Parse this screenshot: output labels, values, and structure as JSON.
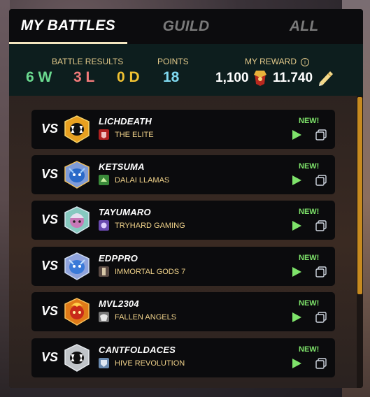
{
  "tabs": [
    {
      "label": "MY BATTLES",
      "active": true
    },
    {
      "label": "GUILD",
      "active": false
    },
    {
      "label": "ALL",
      "active": false
    }
  ],
  "summary": {
    "battle_results_label": "BATTLE RESULTS",
    "points_label": "POINTS",
    "reward_label": "MY REWARD",
    "wins": "6 W",
    "losses": "3 L",
    "draws": "0 D",
    "points": "18",
    "reward_merits": "1,100",
    "reward_sps": "11.740"
  },
  "battles": [
    {
      "vs": "VS",
      "player": "LICHDEATH",
      "guild": "THE ELITE",
      "new": "NEW!",
      "avatar": "fanged-mouth-icon",
      "avatar_color": "#e8a020",
      "guild_color": "#b02020"
    },
    {
      "vs": "VS",
      "player": "KETSUMA",
      "guild": "DALAI LLAMAS",
      "new": "NEW!",
      "avatar": "blue-dragon-icon",
      "avatar_color": "#7e9bd8",
      "guild_color": "#3a8a3a"
    },
    {
      "vs": "VS",
      "player": "TAYUMARO",
      "guild": "TRYHARD GAMING",
      "new": "NEW!",
      "avatar": "mage-icon",
      "avatar_color": "#86c9c0",
      "guild_color": "#6a4ab0"
    },
    {
      "vs": "VS",
      "player": "EDPPRO",
      "guild": "IMMORTAL GODS 7",
      "new": "NEW!",
      "avatar": "blue-dragon-icon",
      "avatar_color": "#8fa3dc",
      "guild_color": "#5a4a44"
    },
    {
      "vs": "VS",
      "player": "MVL2304",
      "guild": "FALLEN ANGELS",
      "new": "NEW!",
      "avatar": "fire-demon-icon",
      "avatar_color": "#e07a18",
      "guild_color": "#777777"
    },
    {
      "vs": "VS",
      "player": "CANTFOLDACES",
      "guild": "HIVE REVOLUTION",
      "new": "NEW!",
      "avatar": "fanged-mouth-icon",
      "avatar_color": "#c0c4c8",
      "guild_color": "#6a8ab0"
    }
  ]
}
